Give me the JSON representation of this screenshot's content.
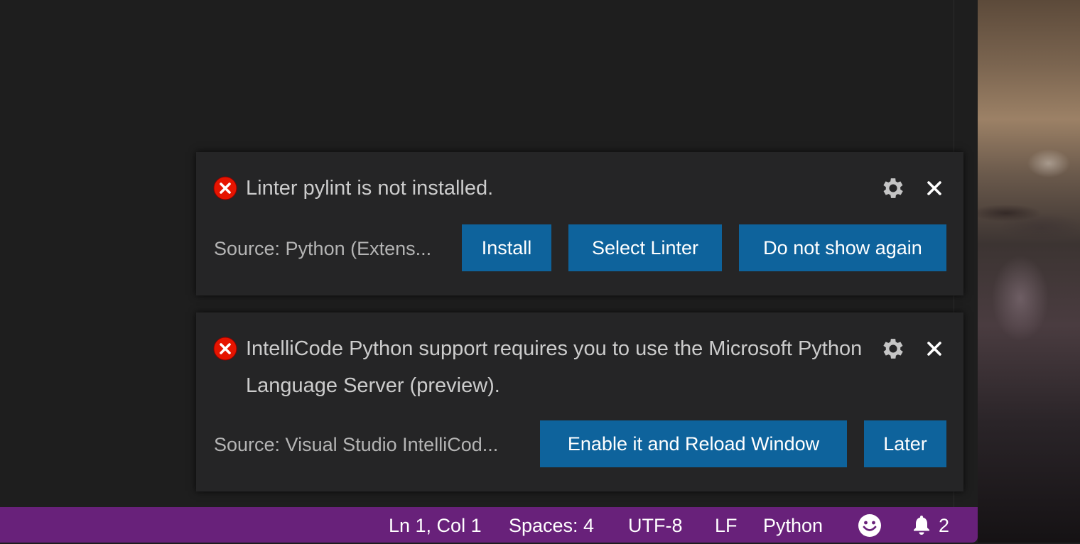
{
  "notifications": [
    {
      "icon": "error-icon",
      "message": "Linter pylint is not installed.",
      "source": "Source: Python (Extens...",
      "buttons": [
        "Install",
        "Select Linter",
        "Do not show again"
      ]
    },
    {
      "icon": "error-icon",
      "message": "IntelliCode Python support requires you to use the Microsoft Python Language Server (preview).",
      "source": "Source: Visual Studio IntelliCod...",
      "buttons": [
        "Enable it and Reload Window",
        "Later"
      ]
    }
  ],
  "statusbar": {
    "position": "Ln 1, Col 1",
    "indent": "Spaces: 4",
    "encoding": "UTF-8",
    "eol": "LF",
    "language": "Python",
    "feedback_icon": "smiley-icon",
    "bell_icon": "bell-icon",
    "notification_count": "2"
  },
  "colors": {
    "statusbar_bg": "#68217a",
    "button_bg": "#0e639c",
    "error_red": "#e51400",
    "toast_bg": "#252526",
    "editor_bg": "#1e1e1e"
  }
}
